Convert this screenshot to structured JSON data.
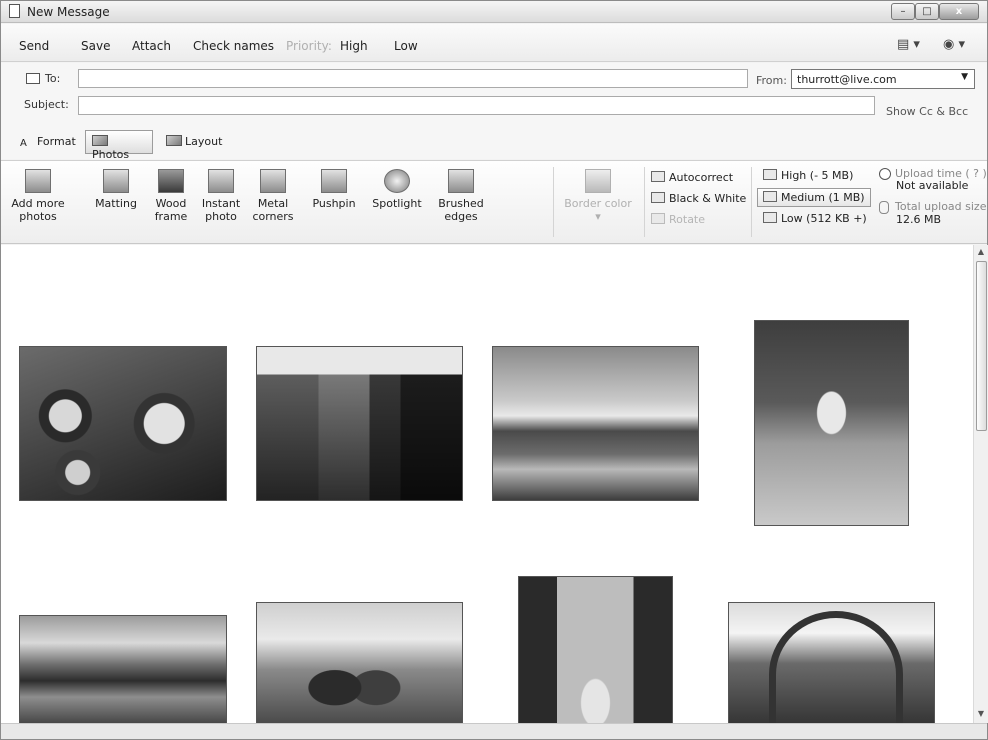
{
  "window": {
    "title": "New Message",
    "controls": {
      "minimize": "–",
      "maximize": "□",
      "close": "x"
    }
  },
  "menu": {
    "send": "Send",
    "save": "Save",
    "attach": "Attach",
    "check_names": "Check names",
    "priority": "Priority:",
    "high": "High",
    "low": "Low",
    "view_icon": "view-menu-icon",
    "help_icon": "help-icon"
  },
  "header": {
    "to_label": "To:",
    "to_value": "",
    "from_label": "From:",
    "from_value": "thurrott@live.com",
    "subject_label": "Subject:",
    "subject_value": "",
    "show_cc_bcc": "Show Cc & Bcc"
  },
  "tabs": [
    {
      "label": "Format",
      "active": false
    },
    {
      "label": "Photos",
      "active": true
    },
    {
      "label": "Layout",
      "active": false
    }
  ],
  "ribbon": {
    "add_more_line1": "Add more",
    "add_more_line2": "photos",
    "effects": [
      {
        "line1": "Matting",
        "line2": ""
      },
      {
        "line1": "Wood",
        "line2": "frame"
      },
      {
        "line1": "Instant",
        "line2": "photo"
      },
      {
        "line1": "Metal",
        "line2": "corners"
      },
      {
        "line1": "Pushpin",
        "line2": ""
      },
      {
        "line1": "Spotlight",
        "line2": ""
      },
      {
        "line1": "Brushed",
        "line2": "edges"
      }
    ],
    "border_color": "Border color",
    "border_color_arrow": "▾",
    "autocorrect": "Autocorrect",
    "black_white": "Black & White",
    "rotate": "Rotate",
    "size_high": "High (- 5 MB)",
    "size_medium": "Medium (1 MB)",
    "size_low": "Low (512 KB +)",
    "upload_time_label": "Upload time ( ? )",
    "upload_time_value": "Not available",
    "total_size_label": "Total upload size",
    "total_size_value": "12.6 MB"
  },
  "colors": {
    "toolbar_bg": "#f3f3f3",
    "content_bg": "#ffffff",
    "disabled_text": "#b0b0b0"
  },
  "photos": [
    {
      "name": "photo-coffee-cups"
    },
    {
      "name": "photo-paris-street"
    },
    {
      "name": "photo-park-eiffel-view"
    },
    {
      "name": "photo-statue"
    },
    {
      "name": "photo-river-bridge"
    },
    {
      "name": "photo-couple-riverside"
    },
    {
      "name": "photo-tree-lined-path"
    },
    {
      "name": "photo-eiffel-tower-base"
    }
  ]
}
